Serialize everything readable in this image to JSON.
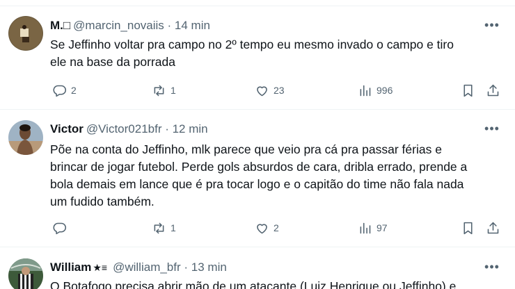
{
  "tweets": [
    {
      "name": "M.□",
      "badge": "",
      "handle": "@marcin_novaiis",
      "time": "· 14 min",
      "text": "Se Jeffinho voltar pra campo no 2º tempo eu mesmo invado o campo e tiro\nele na base da porrada",
      "replies": "2",
      "retweets": "1",
      "likes": "23",
      "views": "996"
    },
    {
      "name": "Victor",
      "badge": "",
      "handle": "@Victor021bfr",
      "time": "· 12 min",
      "text": "Põe na conta do Jeffinho, mlk parece que veio pra cá pra passar férias e\nbrincar de jogar futebol. Perde gols absurdos de cara, dribla errado, prende a\nbola demais em lance que é pra tocar logo e o capitão do time não fala nada\num fudido também.",
      "replies": "",
      "retweets": "1",
      "likes": "2",
      "views": "97"
    },
    {
      "name": "William",
      "badge": "★≡",
      "handle": "@william_bfr",
      "time": "· 13 min",
      "text": "O Botafogo precisa abrir mão de um atacante (Luiz Henrique ou Jeffinho) e"
    }
  ],
  "icons": {
    "more": "more-icon",
    "reply": "reply-icon",
    "retweet": "retweet-icon",
    "like": "heart-icon",
    "views": "views-icon",
    "bookmark": "bookmark-icon",
    "share": "share-icon"
  },
  "colors": {
    "text": "#0f1419",
    "secondary": "#536471",
    "divider": "#eff3f4",
    "background": "#ffffff"
  }
}
